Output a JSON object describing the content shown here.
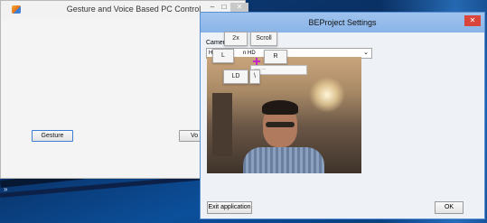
{
  "desktop": {
    "arrow_glyph": "»"
  },
  "main_window": {
    "title": "Gesture and Voice Based PC Control",
    "controls": {
      "minimize": "–",
      "maximize": "□",
      "close": "✕"
    },
    "buttons": {
      "gesture": "Gesture",
      "voice": "Vo"
    }
  },
  "settings_window": {
    "title": "BEProject Settings",
    "close": "✕",
    "camera_label": "Camera",
    "camera_select_value": "HD Webcam HD",
    "camera_select_visible": "H",
    "camera_select_visible_right": "n HD",
    "exit_button": "Exit application",
    "ok_button": "OK",
    "overlay_buttons": {
      "two_x": "2x",
      "scroll": "Scroll",
      "left": "L",
      "right": "R",
      "left_double": "LD",
      "small": "\\"
    },
    "overlay_pane_text": "---- ---"
  },
  "colors": {
    "accent": "#3c7fd2",
    "titlebar": "#9fc3ee",
    "close_red": "#d9453b",
    "cursor": "#c526c9"
  }
}
